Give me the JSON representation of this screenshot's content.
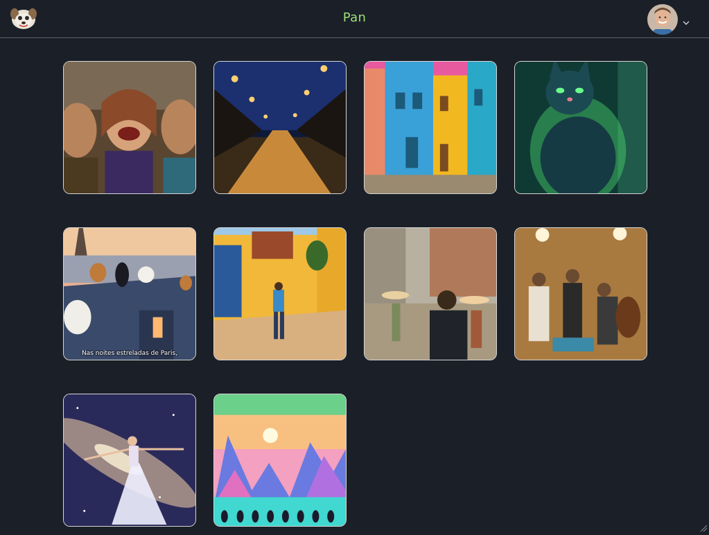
{
  "header": {
    "title": "Pan",
    "logo_icon": "dog-mascot-icon",
    "avatar_icon": "user-avatar",
    "menu_icon": "chevron-down-icon"
  },
  "gallery": {
    "items": [
      {
        "caption": "",
        "scene": "laughing-people"
      },
      {
        "caption": "",
        "scene": "night-street"
      },
      {
        "caption": "",
        "scene": "colorful-houses"
      },
      {
        "caption": "",
        "scene": "green-cat"
      },
      {
        "caption": "Nas noites estreladas de Paris,",
        "scene": "paris-cats"
      },
      {
        "caption": "",
        "scene": "yellow-wall-walker"
      },
      {
        "caption": "",
        "scene": "vintage-street"
      },
      {
        "caption": "",
        "scene": "musicians"
      },
      {
        "caption": "",
        "scene": "galaxy-dancer"
      },
      {
        "caption": "",
        "scene": "penguins-landscape"
      }
    ]
  },
  "colors": {
    "background": "#1b1f27",
    "title": "#9be07a",
    "card_border": "#d7d7d7"
  }
}
